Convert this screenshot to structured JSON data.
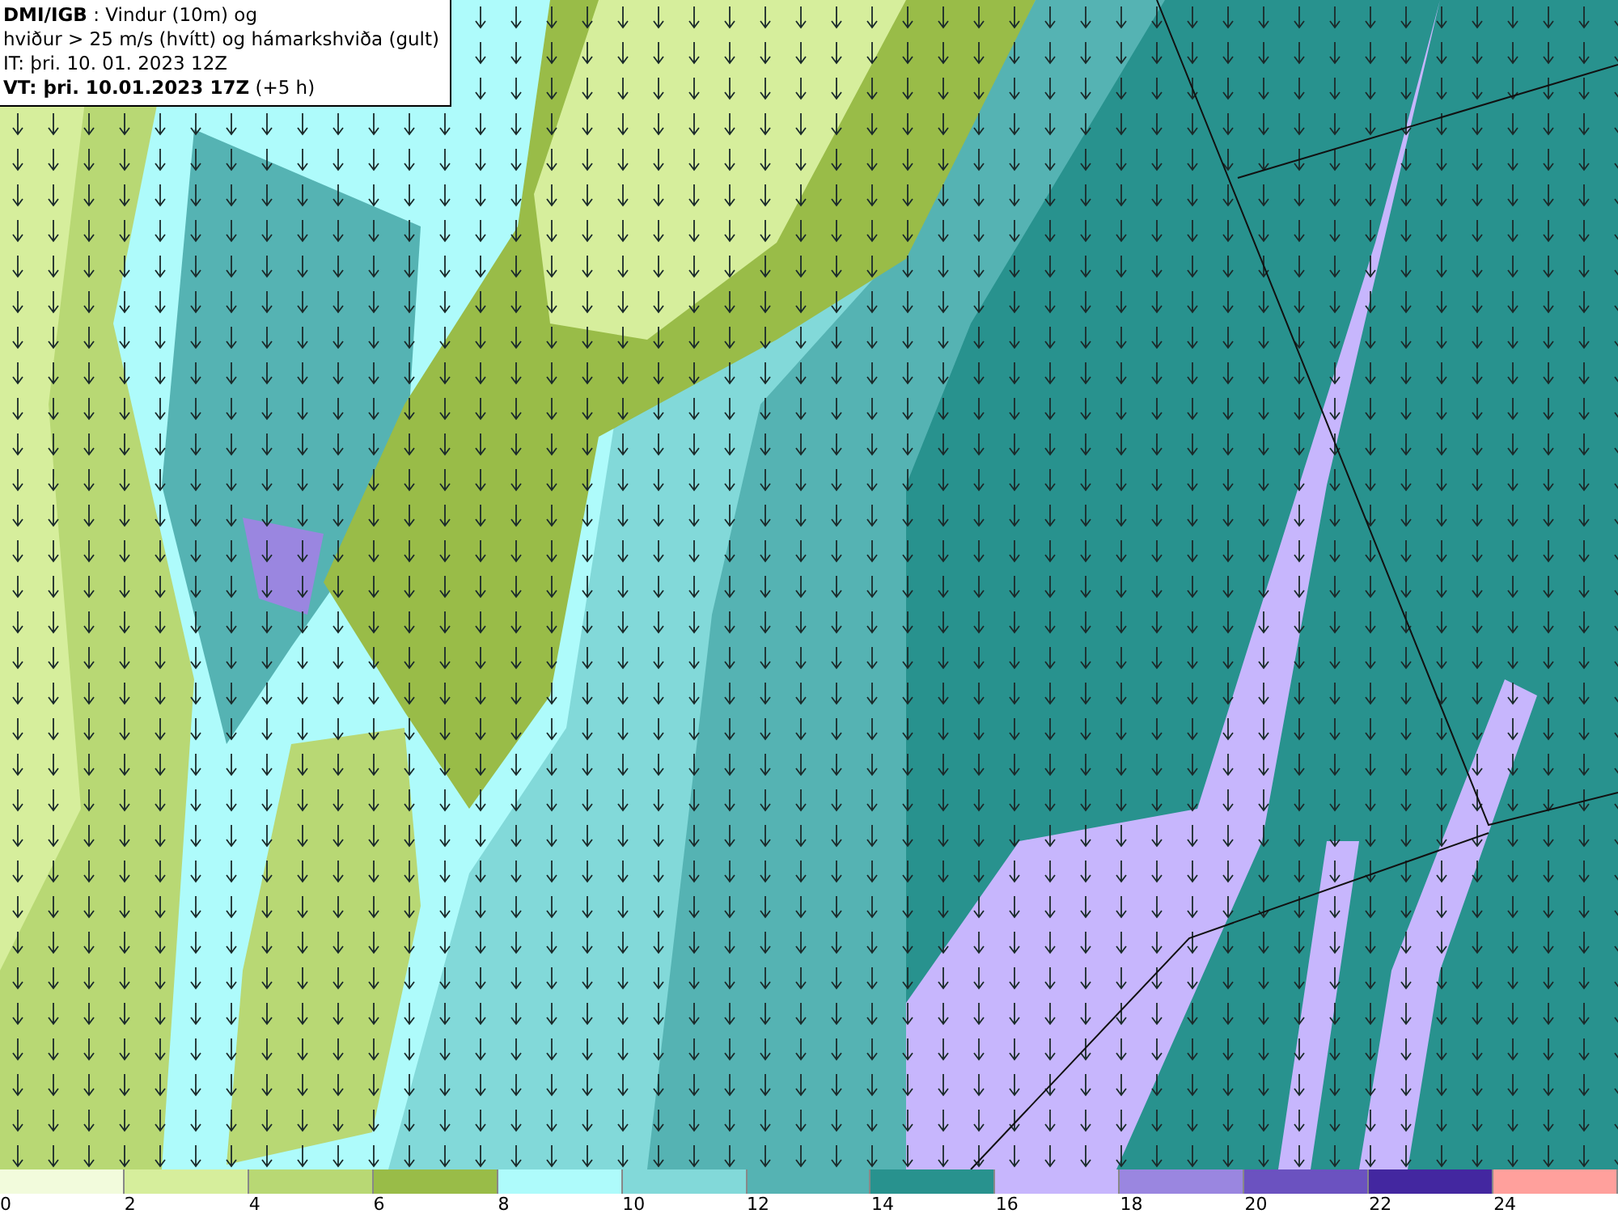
{
  "header": {
    "lines": [
      "**DMI/IGB** : Vindur (10m) og",
      "hviður > 25 m/s (hvítt) og hámarkshviða (gult)",
      "IT: þri. 10. 01. 2023 12Z",
      "**VT: þri. 10.01.2023 17Z** (+5 h)"
    ]
  },
  "legend": [
    {
      "label": "0",
      "color": "#f2fbdc"
    },
    {
      "label": "2",
      "color": "#d6ee9c"
    },
    {
      "label": "4",
      "color": "#b8d874"
    },
    {
      "label": "6",
      "color": "#99bc48"
    },
    {
      "label": "8",
      "color": "#aefbfb"
    },
    {
      "label": "10",
      "color": "#82d9d9"
    },
    {
      "label": "12",
      "color": "#55b3b3"
    },
    {
      "label": "14",
      "color": "#28928e"
    },
    {
      "label": "16",
      "color": "#c7b6fd"
    },
    {
      "label": "18",
      "color": "#9a86e0"
    },
    {
      "label": "20",
      "color": "#6b52c0"
    },
    {
      "label": "22",
      "color": "#4327a0"
    },
    {
      "label": "24",
      "color": "#ffa09c"
    }
  ]
}
